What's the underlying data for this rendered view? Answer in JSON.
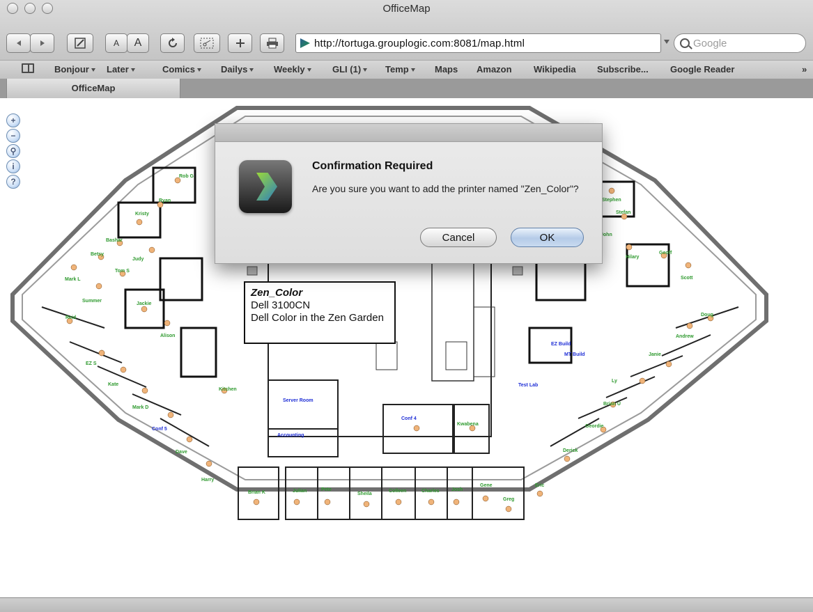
{
  "window": {
    "title": "OfficeMap"
  },
  "toolbar": {
    "url": "http://tortuga.grouplogic.com:8081/map.html",
    "search_placeholder": "Google",
    "buttons": {
      "back_icon": "back-arrow-icon",
      "forward_icon": "forward-arrow-icon",
      "edit_icon": "pencil-icon",
      "font_small": "A",
      "font_large": "A",
      "reload_icon": "reload-icon",
      "snippet_icon": "scissors-icon",
      "add_icon": "plus-icon",
      "print_icon": "printer-icon"
    }
  },
  "bookmarks": [
    {
      "label": "Bonjour",
      "menu": true
    },
    {
      "label": "Later",
      "menu": true
    },
    {
      "label": "Comics",
      "menu": true
    },
    {
      "label": "Dailys",
      "menu": true
    },
    {
      "label": "Weekly",
      "menu": true
    },
    {
      "label": "GLI (1)",
      "menu": true
    },
    {
      "label": "Temp",
      "menu": true
    },
    {
      "label": "Maps",
      "menu": false
    },
    {
      "label": "Amazon",
      "menu": false
    },
    {
      "label": "Wikipedia",
      "menu": false
    },
    {
      "label": "Subscribe...",
      "menu": false
    },
    {
      "label": "Google Reader",
      "menu": false
    }
  ],
  "tab": {
    "label": "OfficeMap"
  },
  "map": {
    "zoom_controls": [
      "zoom-in-icon",
      "zoom-out-icon",
      "binoculars-icon",
      "info-icon",
      "help-icon"
    ],
    "people": [
      "Rob G",
      "Ryan",
      "Kristy",
      "Bashar",
      "Betsy",
      "Judy",
      "Tom S",
      "Mark L",
      "Summer",
      "Jackie",
      "Alison",
      "Reid",
      "EZ S",
      "Kate",
      "Mark D",
      "Conf 5",
      "Dave",
      "Harry",
      "Brian K",
      "Julian",
      "Pete",
      "Sheila",
      "Colleen",
      "Charles",
      "Josh",
      "Gene",
      "Greg",
      "Eric",
      "Derick",
      "Geordie",
      "Brian U",
      "Ly",
      "Janie",
      "Andrew",
      "Doug",
      "Scott",
      "Geoff",
      "Hilary",
      "Stefan",
      "Stephen",
      "John"
    ],
    "rooms": [
      "Kitchen",
      "Server Room",
      "Accounting",
      "Conf 4",
      "Kwabena",
      "Test Lab",
      "EZ Build",
      "MT Build"
    ]
  },
  "printer_tooltip": {
    "name": "Zen_Color",
    "model": "Dell 3100CN",
    "description": "Dell Color in the Zen Garden"
  },
  "dialog": {
    "title": "Confirmation Required",
    "message": "Are you sure you want to add the printer named \"Zen_Color\"?",
    "cancel_label": "Cancel",
    "ok_label": "OK"
  }
}
